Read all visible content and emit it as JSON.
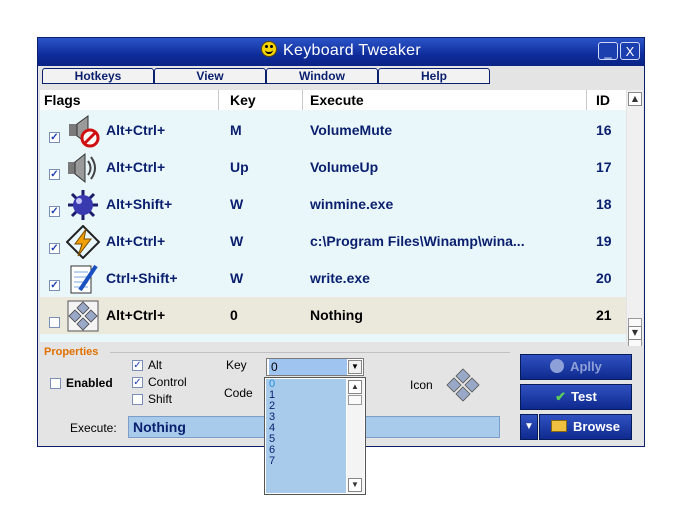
{
  "window": {
    "title": "Keyboard Tweaker",
    "minimize_label": "_",
    "close_label": "X"
  },
  "menu": [
    "Hotkeys",
    "View",
    "Window",
    "Help"
  ],
  "columns": {
    "flags": "Flags",
    "key": "Key",
    "execute": "Execute",
    "id": "ID"
  },
  "rows": [
    {
      "checked": true,
      "icon": "volume-mute-icon",
      "flags": "Alt+Ctrl+",
      "key": "M",
      "execute": "VolumeMute",
      "id": "16"
    },
    {
      "checked": true,
      "icon": "volume-up-icon",
      "flags": "Alt+Ctrl+",
      "key": "Up",
      "execute": "VolumeUp",
      "id": "17"
    },
    {
      "checked": true,
      "icon": "minesweeper-icon",
      "flags": "Alt+Shift+",
      "key": "W",
      "execute": "winmine.exe",
      "id": "18"
    },
    {
      "checked": true,
      "icon": "winamp-icon",
      "flags": "Alt+Ctrl+",
      "key": "W",
      "execute": "c:\\Program Files\\Winamp\\wina...",
      "id": "19"
    },
    {
      "checked": true,
      "icon": "write-icon",
      "flags": "Ctrl+Shift+",
      "key": "W",
      "execute": "write.exe",
      "id": "20"
    },
    {
      "checked": false,
      "icon": "keys-icon",
      "flags": "Alt+Ctrl+",
      "key": "0",
      "execute": "Nothing",
      "id": "21",
      "selected": true
    }
  ],
  "properties": {
    "section_label": "Properties",
    "enabled_label": "Enabled",
    "enabled": false,
    "alt_label": "Alt",
    "alt": true,
    "control_label": "Control",
    "control": true,
    "shift_label": "Shift",
    "shift": false,
    "key_label": "Key",
    "key_value": "0",
    "code_label": "Code",
    "icon_label": "Icon",
    "execute_label": "Execute:",
    "execute_value": "Nothing"
  },
  "buttons": {
    "apply": "Aplly",
    "test": "Test",
    "browse": "Browse"
  },
  "key_dropdown_options": [
    "0",
    "1",
    "2",
    "3",
    "4",
    "5",
    "6",
    "7"
  ],
  "colors": {
    "title_bar": "#0f2c9b",
    "list_bg": "#e9f7fb",
    "accent_orange": "#e07000",
    "text_navy": "#0a1f6e"
  }
}
